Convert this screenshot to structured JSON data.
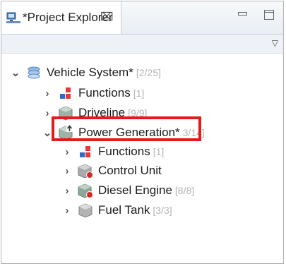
{
  "tab": {
    "title": "*Project Explorer",
    "close_glyph": "⌧"
  },
  "view_menu_glyph": "▽",
  "tree": [
    {
      "name": "Vehicle System*",
      "count": "[2/25]",
      "icon": "system-icon",
      "expanded": true,
      "level": 0
    },
    {
      "name": "Functions",
      "count": "[1]",
      "icon": "functions-icon",
      "expanded": false,
      "level": 1
    },
    {
      "name": "Driveline",
      "count": "[9/9]",
      "icon": "component-icon",
      "expanded": false,
      "level": 1
    },
    {
      "name": "Power Generation*",
      "count": "3/14]",
      "icon": "component-upload-icon",
      "expanded": true,
      "level": 1
    },
    {
      "name": "Functions",
      "count": "[1]",
      "icon": "functions-icon",
      "expanded": false,
      "level": 2
    },
    {
      "name": "Control Unit",
      "count": "",
      "icon": "component-error-icon",
      "expanded": false,
      "level": 2
    },
    {
      "name": "Diesel Engine",
      "count": "[8/8]",
      "icon": "component-error-icon",
      "expanded": false,
      "level": 2
    },
    {
      "name": "Fuel Tank",
      "count": "[3/3]",
      "icon": "component-icon",
      "expanded": false,
      "level": 2
    }
  ],
  "colors": {
    "highlight": "#e31b1b",
    "count_text": "#b5b5b5"
  }
}
